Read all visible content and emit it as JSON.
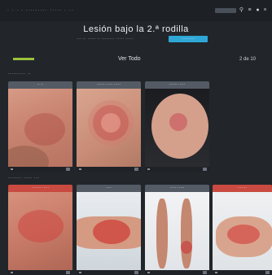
{
  "topbar": {
    "left_text": "· · · ·  ·········  ····· · ··",
    "icons": [
      "search-icon",
      "menu-icon",
      "user-icon",
      "close-icon"
    ]
  },
  "hero": {
    "title": "Lesión bajo la 2.ª rodilla",
    "subtitle": "··· ·· ····· ·· ········ ····· ·····",
    "cta_label": "··········"
  },
  "toolbar": {
    "progress": 1.0,
    "center_label": "Ver Todo",
    "right_label": "2 de 10"
  },
  "sections": [
    {
      "label": "··········  ··",
      "cards": [
        {
          "caption": "·· ··",
          "caption_color": "gray"
        },
        {
          "caption": "······ ····· ·····",
          "caption_color": "gray"
        },
        {
          "caption": "······ ·····",
          "caption_color": "gray"
        }
      ]
    },
    {
      "label": "········ ·····  ···",
      "cards": [
        {
          "caption": "······· ·····",
          "caption_color": "red"
        },
        {
          "caption": "····",
          "caption_color": "gray"
        },
        {
          "caption": "····· ·····",
          "caption_color": "gray"
        },
        {
          "caption": "·······",
          "caption_color": "red"
        }
      ]
    }
  ],
  "colors": {
    "background": "#22262b",
    "accent": "#2fa7d6",
    "progress": "#9bc33a",
    "caption_red": "#c84a40",
    "caption_gray": "#555b64"
  }
}
